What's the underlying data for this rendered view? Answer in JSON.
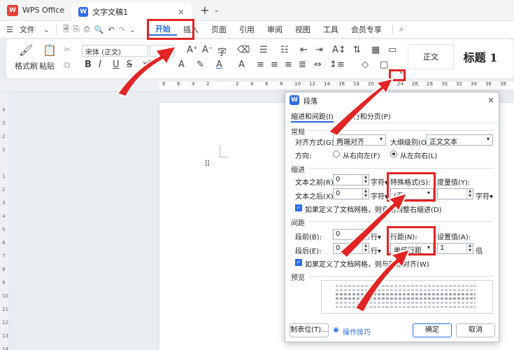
{
  "titlebar": {
    "app_tab": "WPS Office",
    "doc_tab": "文字文稿1",
    "doc_logo": "W",
    "close": "×",
    "plus": "+",
    "chevron": "⌄"
  },
  "menu": {
    "file": "文件",
    "items": [
      "开始",
      "插入",
      "页面",
      "引用",
      "审阅",
      "视图",
      "工具",
      "会员专享"
    ]
  },
  "ribbon": {
    "format_painter": "格式刷",
    "paste": "粘贴",
    "font_name": "宋体 (正文)",
    "style_normal": "正文",
    "style_heading": "标题 1"
  },
  "ruler": {
    "ticks": [
      "8",
      "6",
      "4",
      "2",
      "",
      "2",
      "4",
      "6",
      "8",
      "10",
      "12",
      "14",
      "16",
      "18",
      "20",
      "22",
      "24",
      "26",
      "28",
      "30",
      "32",
      "34",
      "36",
      "38"
    ],
    "vticks": [
      "4",
      "3",
      "2",
      "1",
      "",
      "1",
      "2",
      "3",
      "4",
      "5",
      "6",
      "7",
      "8",
      "9",
      "10",
      "11",
      "12",
      "13",
      "14"
    ]
  },
  "dialog": {
    "title": "段落",
    "logo": "W",
    "close": "×",
    "tab_indent": "缩进和间距(I)",
    "tab_break": "换行和分页(P)",
    "sec_general": "常规",
    "align_label": "对齐方式(G):",
    "align_value": "两端对齐",
    "outline_label": "大纲级别(O):",
    "outline_value": "正文文本",
    "direction_label": "方向:",
    "rtl": "从右向左(F)",
    "ltr": "从左向右(L)",
    "sec_indent": "缩进",
    "before_text_label": "文本之前(R):",
    "before_text_value": "0",
    "after_text_label": "文本之后(X):",
    "after_text_value": "0",
    "unit_char": "字符▾",
    "special_label": "特殊格式(S):",
    "special_value": "(无)",
    "measure_label": "度量值(Y):",
    "measure_unit": "字符▾",
    "grid_indent_check": "如果定义了文档网格，则自动调整右缩进(D)",
    "sec_spacing": "间距",
    "before_label": "段前(B):",
    "before_value": "0",
    "after_label": "段后(E):",
    "after_value": "0",
    "unit_line": "行▾",
    "line_spacing_label": "行距(N):",
    "line_spacing_value": "单倍行距",
    "setting_label": "设置值(A):",
    "setting_value": "1",
    "setting_unit": "倍",
    "grid_align_check": "如果定义了文档网格，则与网格对齐(W)",
    "sec_preview": "预览",
    "tabs_button": "制表位(T)...",
    "tips_link": "操作技巧",
    "ok_button": "确定",
    "cancel_button": "取消"
  },
  "colors": {
    "accent": "#2d6ce5",
    "highlight": "#e22424",
    "wps_red": "#e0433b"
  }
}
